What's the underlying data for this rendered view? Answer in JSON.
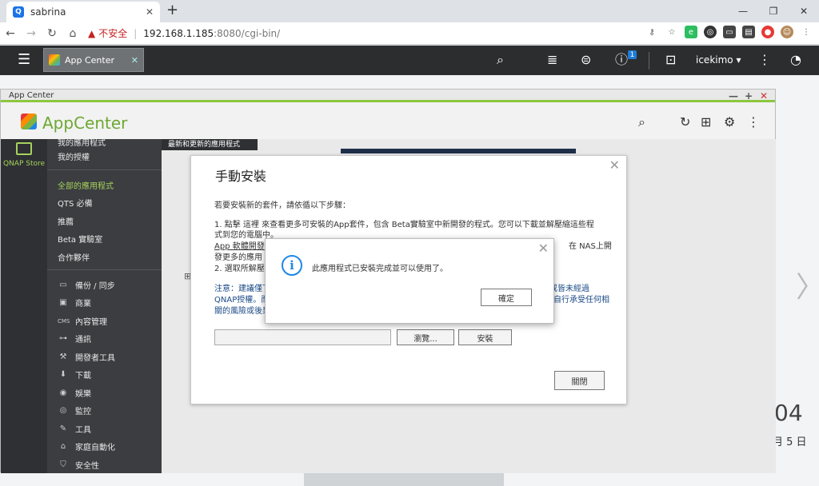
{
  "browser": {
    "tab_title": "sabrina",
    "new_tab": "+",
    "win_controls": [
      "—",
      "❐",
      "✕"
    ],
    "insecure_label": "不安全",
    "url_host": "192.168.1.185",
    "url_path": ":8080/cgi-bin/"
  },
  "qnap_bar": {
    "app_tab_label": "App Center",
    "notification_count": "1",
    "username": "icekimo ▾"
  },
  "window": {
    "title": "App Center",
    "app_name": "AppCenter",
    "store_label": "QNAP Store",
    "content_tab": "最新和更新的應用程式"
  },
  "sidebar": {
    "top_items": [
      "我的應用程式",
      "我的授權"
    ],
    "main_items": [
      "全部的應用程式",
      "QTS 必備",
      "推薦",
      "Beta 實驗室",
      "合作夥伴"
    ],
    "categories": [
      {
        "label": "備份 / 同步",
        "icon": "backup-icon"
      },
      {
        "label": "商業",
        "icon": "business-icon"
      },
      {
        "label": "內容管理",
        "icon": "cms-icon"
      },
      {
        "label": "通訊",
        "icon": "communication-icon"
      },
      {
        "label": "開發者工具",
        "icon": "developer-tools-icon"
      },
      {
        "label": "下載",
        "icon": "download-icon"
      },
      {
        "label": "娛樂",
        "icon": "entertainment-icon"
      },
      {
        "label": "監控",
        "icon": "surveillance-icon"
      },
      {
        "label": "工具",
        "icon": "tools-icon"
      },
      {
        "label": "家庭自動化",
        "icon": "home-automation-icon"
      },
      {
        "label": "安全性",
        "icon": "security-icon"
      }
    ]
  },
  "manual_install": {
    "title": "手動安裝",
    "intro": "若要安裝新的套件，請依循以下步驟：",
    "step1_a": "1. 點擊 這裡 來查看更多可安裝的App套件，包含 Beta實驗室中新開發的程式。您可以下載並解壓縮這些程",
    "step1_b": "式到您的電腦中。",
    "step1_c": "App 軟體開發",
    "step1_d": "在 NAS上開",
    "step1_e": "發更多的應用",
    "step2": "2. 選取所解壓縮",
    "note_a": "注意：建議僅下",
    "note_a2": "或皆未經過",
    "note_b": "QNAP授權。而",
    "note_b2": "自行承受任何相",
    "note_c": "關的風險或後果",
    "browse_button": "瀏覽...",
    "install_button": "安裝",
    "close_button": "關閉"
  },
  "alert": {
    "message": "此應用程式已安裝完成並可以使用了。",
    "ok_button": "確定"
  },
  "desktop": {
    "clock_partial": "04",
    "date_partial": "月 5 日"
  }
}
